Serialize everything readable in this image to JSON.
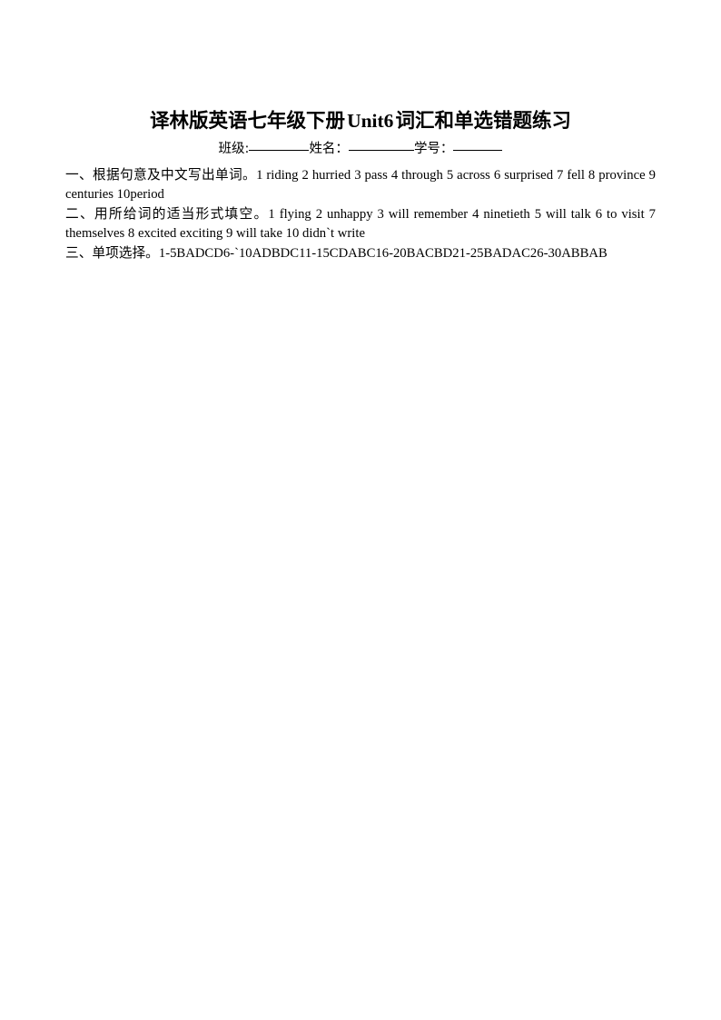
{
  "document": {
    "title_cn_part1": "译林版英语七年级下册",
    "title_latin": "Unit6",
    "title_cn_part2": "词汇和单选错题练习",
    "title_full": "译林版英语七年级下册 Unit6 词汇和单选错题练习",
    "info_line": {
      "class_label": "班级:",
      "name_label": "姓名：",
      "id_label": "学号：",
      "class_value": "",
      "name_value": "",
      "id_value": ""
    },
    "sections": [
      {
        "marker": "一、",
        "heading": "根据句意及中文写出单词。",
        "answers": "1 riding 2 hurried 3 pass 4 through 5 across 6   surprised 7 fell 8 province 9 centuries 10period"
      },
      {
        "marker": "二、",
        "heading": "用所给词的适当形式填空。",
        "answers": "1 flying 2 unhappy 3 will remember 4 ninetieth 5  will talk 6 to visit 7 themselves 8 excited exciting 9 will take 10 didn`t write"
      },
      {
        "marker": "三、",
        "heading": "单项选择。",
        "answers": "1-5BADCD6-`10ADBDC11-15CDABC16-20BACBD21-25BADAC26-30ABBAB"
      }
    ]
  },
  "colors": {
    "page_background": "#ffffff",
    "text": "#000000",
    "rule": "#000000"
  }
}
